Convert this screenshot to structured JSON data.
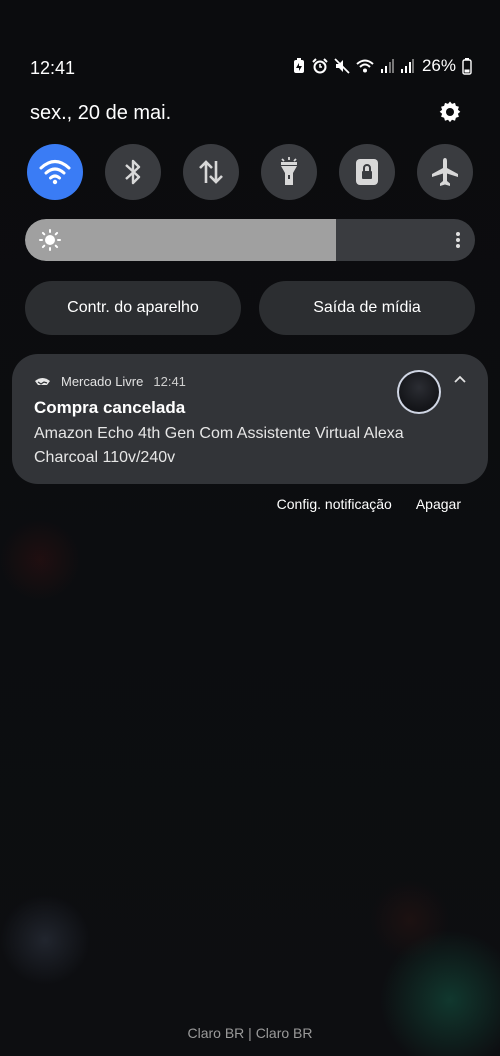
{
  "status_bar": {
    "time": "12:41",
    "battery": "26%"
  },
  "header": {
    "date": "sex., 20 de mai."
  },
  "quick_toggles": [
    {
      "name": "wifi-icon",
      "active": true
    },
    {
      "name": "bluetooth-icon",
      "active": false
    },
    {
      "name": "mobile-data-icon",
      "active": false
    },
    {
      "name": "flashlight-icon",
      "active": false
    },
    {
      "name": "rotation-lock-icon",
      "active": false
    },
    {
      "name": "airplane-mode-icon",
      "active": false
    }
  ],
  "brightness": {
    "level": 0.69
  },
  "buttons": {
    "device_control": "Contr. do aparelho",
    "media_output": "Saída de mídia"
  },
  "notification": {
    "app": "Mercado Livre",
    "time": "12:41",
    "title": "Compra cancelada",
    "body": "Amazon Echo 4th Gen Com Assistente Virtual Alexa Charcoal 110v/240v"
  },
  "notification_actions": {
    "settings": "Config. notificação",
    "clear": "Apagar"
  },
  "footer": {
    "carrier": "Claro BR | Claro BR"
  },
  "colors": {
    "accent": "#3a7cf5",
    "panel": "#323438",
    "toggle_off": "#3a3c40"
  }
}
